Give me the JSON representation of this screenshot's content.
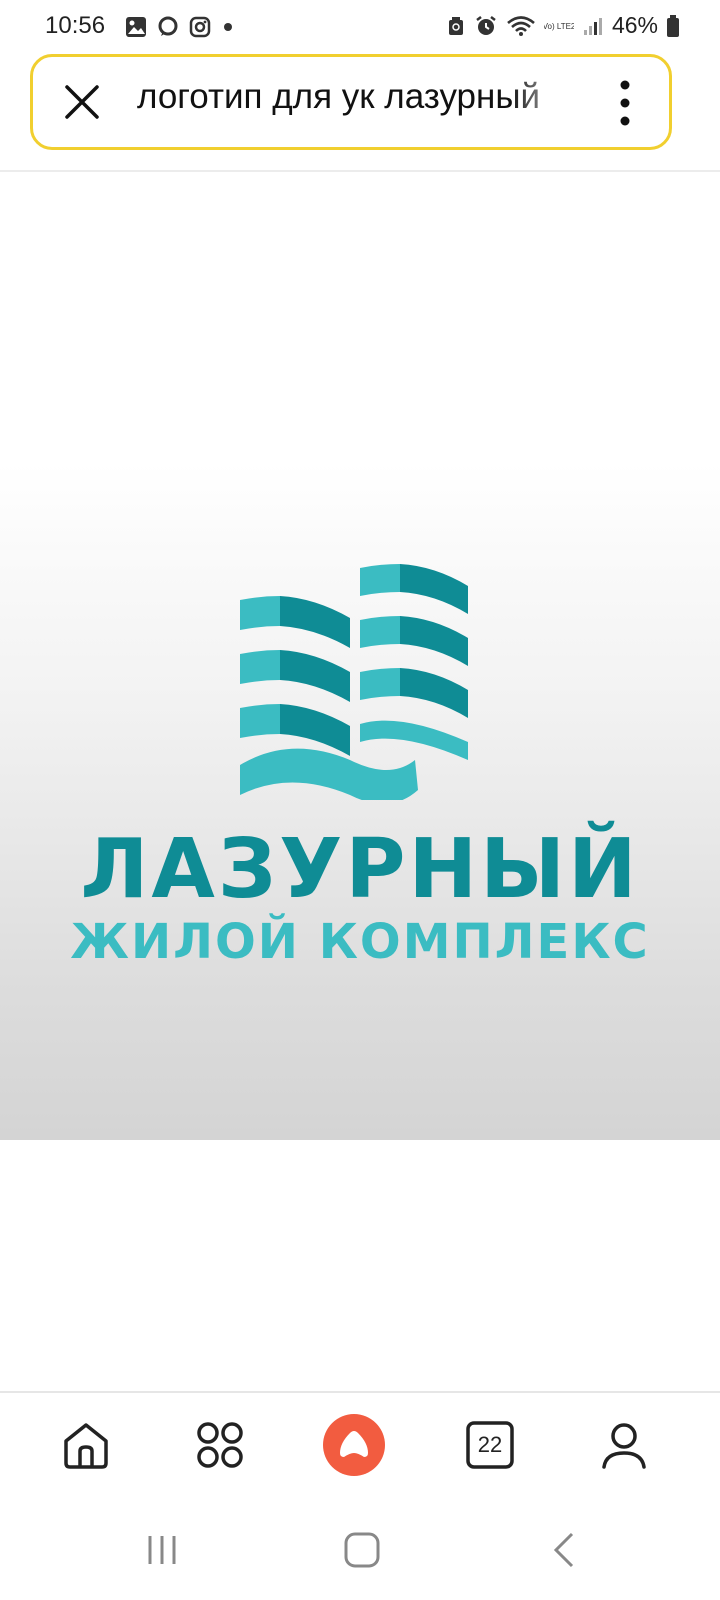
{
  "status_bar": {
    "time": "10:56",
    "battery_percent": "46%",
    "network_label": "Vo) LTE2",
    "left_icons": [
      "gallery-icon",
      "chat-bubble-icon",
      "instagram-icon",
      "dot-icon"
    ],
    "right_icons": [
      "recycle-icon",
      "alarm-icon",
      "wifi-icon",
      "lte-icon",
      "signal-icon",
      "battery-icon"
    ]
  },
  "search": {
    "query": "логотип для ук лазурный"
  },
  "image": {
    "logo_title": "ЛАЗУРНЫЙ",
    "logo_subtitle": "ЖИЛОЙ КОМПЛЕКС",
    "colors": {
      "dark_teal": "#0f8c95",
      "light_teal": "#3bbcc2"
    }
  },
  "bottom_nav": {
    "tabs_count": "22",
    "items": [
      "home-icon",
      "services-grid-icon",
      "alice-assistant-icon",
      "tabs-icon",
      "profile-icon"
    ],
    "accent_color": "#f25c40"
  },
  "system_nav": [
    "recent-apps-icon",
    "home-button-icon",
    "back-icon"
  ]
}
